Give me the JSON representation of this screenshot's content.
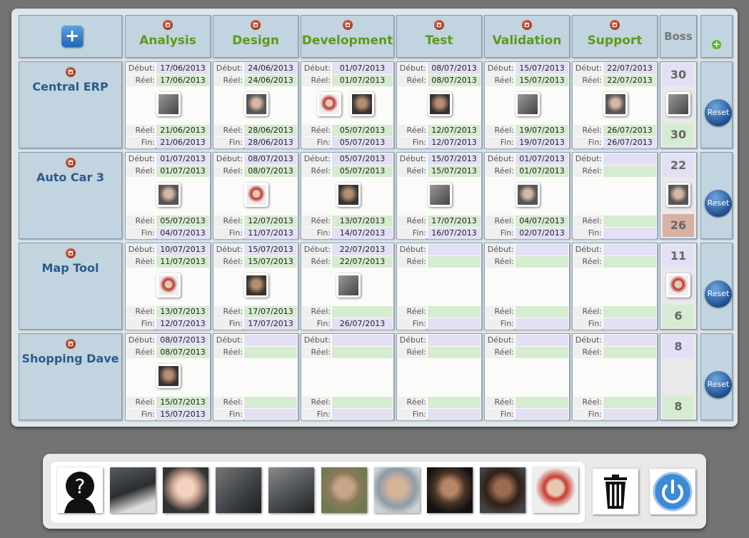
{
  "header": {
    "boss_label": "Boss",
    "columns": [
      "Analysis",
      "Design",
      "Development",
      "Test",
      "Validation",
      "Support"
    ]
  },
  "labels": {
    "debut": "Début:",
    "reel": "Réel:",
    "fin": "Fin:",
    "reset": "Reset"
  },
  "projects": [
    {
      "name": "Central ERP",
      "boss_top": "30",
      "boss_bottom": "30",
      "tasks": [
        {
          "debut": "17/06/2013",
          "reel_start": "17/06/2013",
          "reel_end": "21/06/2013",
          "fin": "21/06/2013"
        },
        {
          "debut": "24/06/2013",
          "reel_start": "24/06/2013",
          "reel_end": "28/06/2013",
          "fin": "28/06/2013"
        },
        {
          "debut": "01/07/2013",
          "reel_start": "01/07/2013",
          "reel_end": "05/07/2013",
          "fin": "05/07/2013"
        },
        {
          "debut": "08/07/2013",
          "reel_start": "08/07/2013",
          "reel_end": "12/07/2013",
          "fin": "12/07/2013"
        },
        {
          "debut": "15/07/2013",
          "reel_start": "15/07/2013",
          "reel_end": "19/07/2013",
          "fin": "19/07/2013"
        },
        {
          "debut": "22/07/2013",
          "reel_start": "22/07/2013",
          "reel_end": "26/07/2013",
          "fin": "26/07/2013"
        }
      ]
    },
    {
      "name": "Auto Car 3",
      "boss_top": "22",
      "boss_bottom": "26",
      "tasks": [
        {
          "debut": "01/07/2013",
          "reel_start": "01/07/2013",
          "reel_end": "05/07/2013",
          "fin": "04/07/2013"
        },
        {
          "debut": "08/07/2013",
          "reel_start": "08/07/2013",
          "reel_end": "12/07/2013",
          "fin": "11/07/2013"
        },
        {
          "debut": "05/07/2013",
          "reel_start": "05/07/2013",
          "reel_end": "13/07/2013",
          "fin": "14/07/2013"
        },
        {
          "debut": "15/07/2013",
          "reel_start": "15/07/2013",
          "reel_end": "17/07/2013",
          "fin": "16/07/2013"
        },
        {
          "debut": "01/07/2013",
          "reel_start": "01/07/2013",
          "reel_end": "04/07/2013",
          "fin": "02/07/2013"
        },
        {
          "debut": "",
          "reel_start": "",
          "reel_end": "",
          "fin": ""
        }
      ]
    },
    {
      "name": "Map Tool",
      "boss_top": "11",
      "boss_bottom": "6",
      "tasks": [
        {
          "debut": "10/07/2013",
          "reel_start": "11/07/2013",
          "reel_end": "13/07/2013",
          "fin": "12/07/2013"
        },
        {
          "debut": "15/07/2013",
          "reel_start": "15/07/2013",
          "reel_end": "17/07/2013",
          "fin": "17/07/2013"
        },
        {
          "debut": "22/07/2013",
          "reel_start": "22/07/2013",
          "reel_end": "",
          "fin": "26/07/2013"
        },
        {
          "debut": "",
          "reel_start": "",
          "reel_end": "",
          "fin": ""
        },
        {
          "debut": "",
          "reel_start": "",
          "reel_end": "",
          "fin": ""
        },
        {
          "debut": "",
          "reel_start": "",
          "reel_end": "",
          "fin": ""
        }
      ]
    },
    {
      "name": "Shopping Dave",
      "boss_top": "8",
      "boss_bottom": "8",
      "tasks": [
        {
          "debut": "08/07/2013",
          "reel_start": "08/07/2013",
          "reel_end": "15/07/2013",
          "fin": "15/07/2013"
        },
        {
          "debut": "",
          "reel_start": "",
          "reel_end": "",
          "fin": ""
        },
        {
          "debut": "",
          "reel_start": "",
          "reel_end": "",
          "fin": ""
        },
        {
          "debut": "",
          "reel_start": "",
          "reel_end": "",
          "fin": ""
        },
        {
          "debut": "",
          "reel_start": "",
          "reel_end": "",
          "fin": ""
        },
        {
          "debut": "",
          "reel_start": "",
          "reel_end": "",
          "fin": ""
        }
      ]
    }
  ],
  "colors": {
    "header_text": "#5c9a1a",
    "project_text": "#2d5a8c",
    "late": "#e0b4a8",
    "purple": "#e3e0f5",
    "green": "#d6ecd0"
  }
}
